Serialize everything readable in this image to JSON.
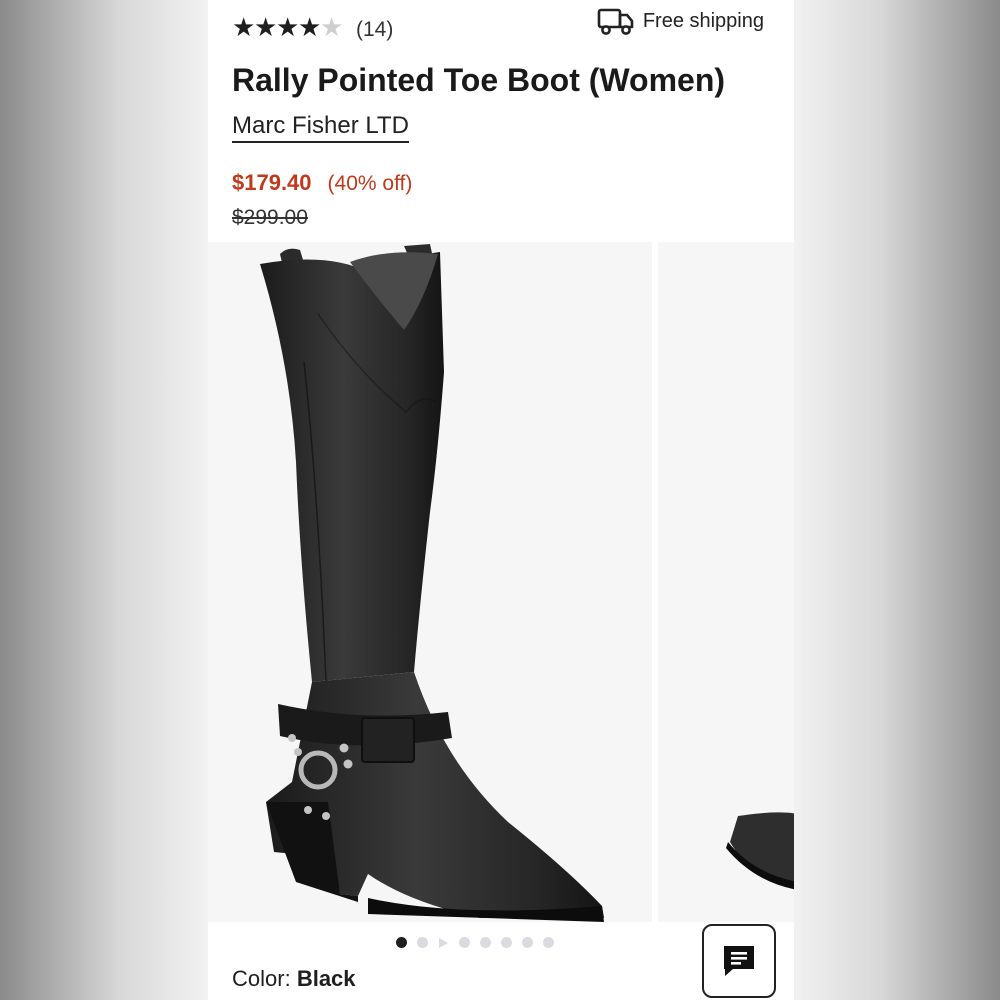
{
  "rating": {
    "value": 4,
    "max": 5,
    "count_label": "(14)"
  },
  "shipping": {
    "label": "Free shipping",
    "icon": "truck-icon"
  },
  "product": {
    "title": "Rally Pointed Toe Boot (Women)",
    "brand": "Marc Fisher LTD",
    "price": "$179.40",
    "discount": "(40% off)",
    "original_price": "$299.00"
  },
  "gallery": {
    "slide_count": 8,
    "active_index": 0,
    "video_index": 2
  },
  "color": {
    "label": "Color:",
    "value": "Black"
  },
  "chat": {
    "icon": "chat-icon"
  },
  "colors": {
    "price_red": "#c0391b",
    "text": "#1f1f1f",
    "dot_inactive": "#d9dbe0"
  }
}
